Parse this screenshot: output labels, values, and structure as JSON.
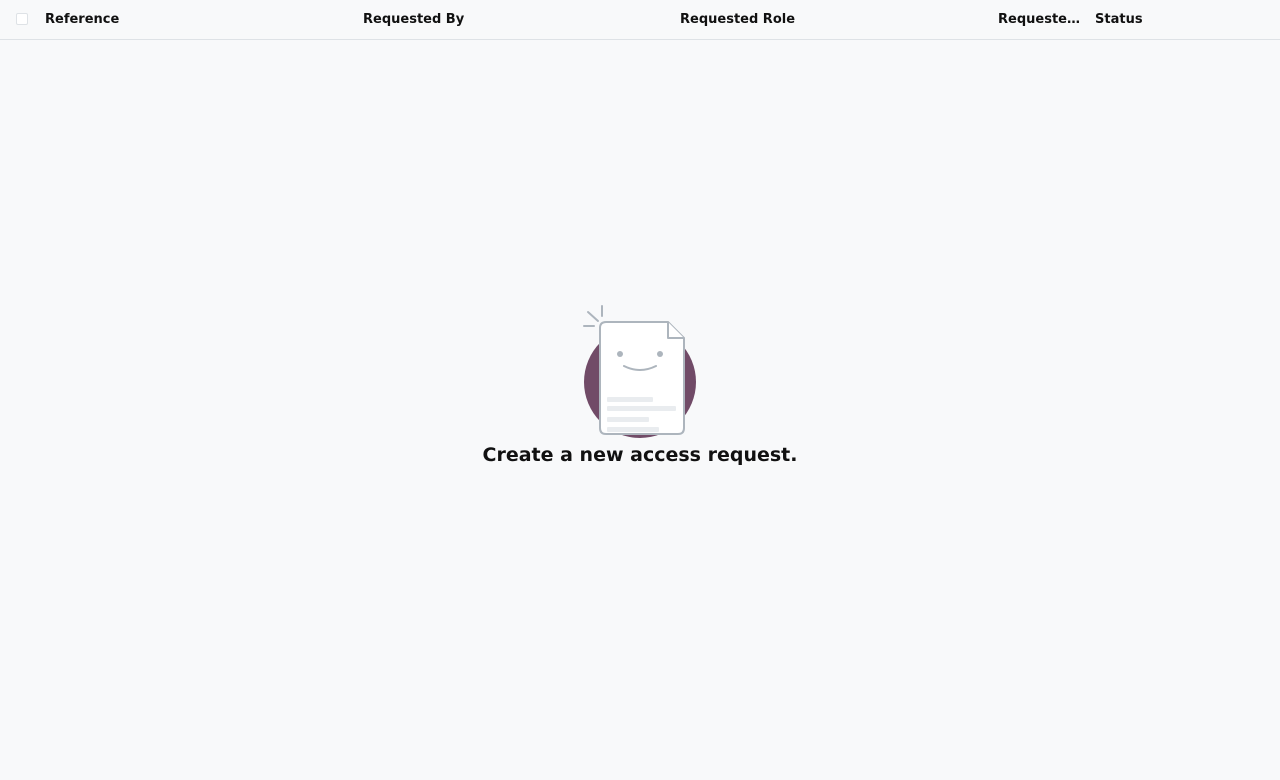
{
  "list": {
    "columns": [
      {
        "label": "Reference"
      },
      {
        "label": "Requested By"
      },
      {
        "label": "Requested Role"
      },
      {
        "label": "Requested ..."
      },
      {
        "label": "Status"
      }
    ]
  },
  "empty_state": {
    "title": "Create a new access request.",
    "illustration_icon": "smiling-document-icon",
    "accent_color": "#714b67"
  }
}
